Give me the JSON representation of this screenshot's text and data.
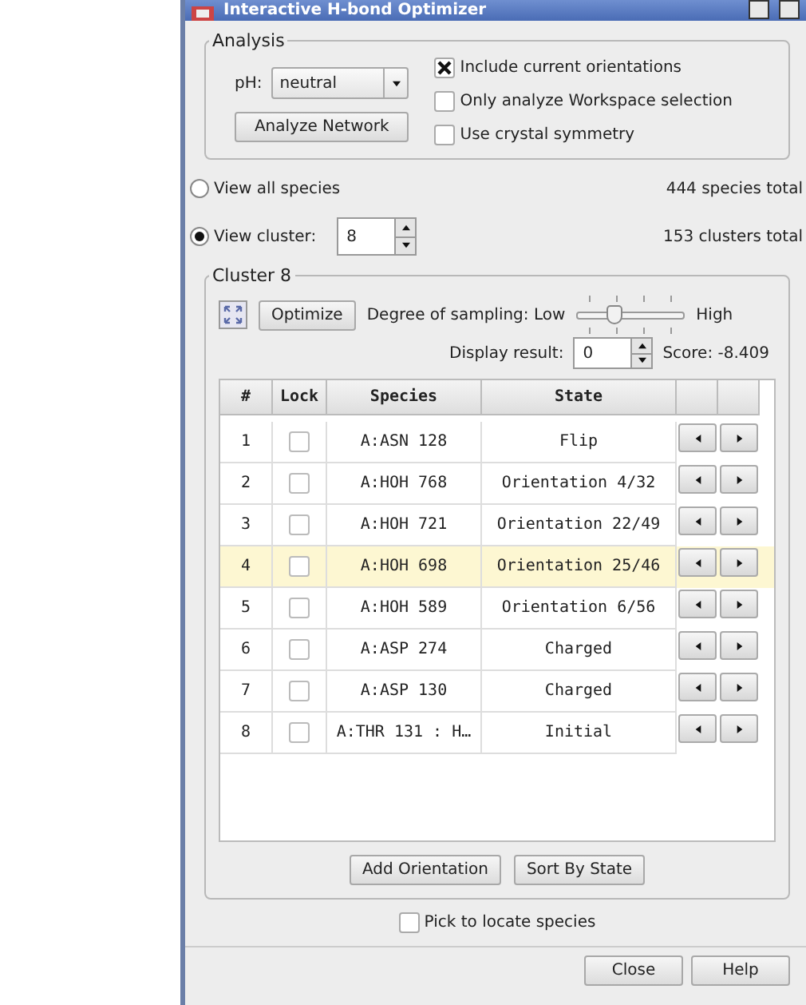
{
  "window": {
    "title": "Interactive H-bond Optimizer"
  },
  "analysis": {
    "title": "Analysis",
    "ph_label": "pH:",
    "ph_value": "neutral",
    "analyze_button": "Analyze Network",
    "options": [
      {
        "label": "Include current orientations",
        "checked": true
      },
      {
        "label": "Only analyze Workspace selection",
        "checked": false
      },
      {
        "label": "Use crystal symmetry",
        "checked": false
      }
    ]
  },
  "view_options": [
    {
      "kind": "plain",
      "label": "View all species",
      "selected": false,
      "total": "444 species total"
    },
    {
      "kind": "spin",
      "label": "View cluster:",
      "selected": true,
      "value": "8",
      "total": "153 clusters total"
    }
  ],
  "cluster": {
    "title": "Cluster 8",
    "optimize_button": "Optimize",
    "sampling_label": "Degree of sampling: Low",
    "high_label": "High",
    "level": 0.35,
    "display_label": "Display result:",
    "display_value": "0",
    "score": "Score: -8.409",
    "columns": [
      "#",
      "Lock",
      "Species",
      "State"
    ],
    "rows": [
      {
        "number": "1",
        "locked": false,
        "species": "A:ASN 128",
        "state": "Flip",
        "selected": false
      },
      {
        "number": "2",
        "locked": false,
        "species": "A:HOH 768",
        "state": "Orientation 4/32",
        "selected": false
      },
      {
        "number": "3",
        "locked": false,
        "species": "A:HOH 721",
        "state": "Orientation 22/49",
        "selected": false
      },
      {
        "number": "4",
        "locked": false,
        "species": "A:HOH 698",
        "state": "Orientation 25/46",
        "selected": true
      },
      {
        "number": "5",
        "locked": false,
        "species": "A:HOH 589",
        "state": "Orientation 6/56",
        "selected": false
      },
      {
        "number": "6",
        "locked": false,
        "species": "A:ASP 274",
        "state": "Charged",
        "selected": false
      },
      {
        "number": "7",
        "locked": false,
        "species": "A:ASP 130",
        "state": "Charged",
        "selected": false
      },
      {
        "number": "8",
        "locked": false,
        "species": "A:THR 131 : H…",
        "state": "Initial",
        "selected": false
      }
    ],
    "buttons": [
      "Add Orientation",
      "Sort By State"
    ]
  },
  "pick": {
    "label": "Pick to locate species",
    "checked": false
  },
  "footer_buttons": [
    "Close",
    "Help"
  ]
}
